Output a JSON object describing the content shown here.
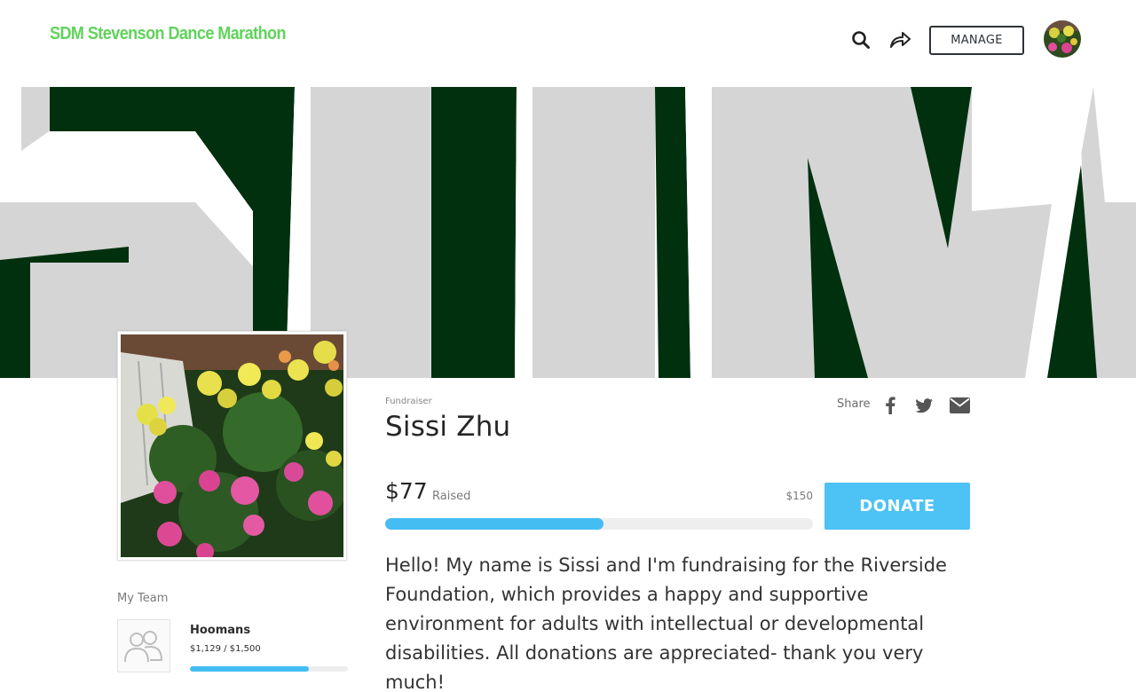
{
  "header": {
    "brand": "SDM Stevenson Dance Marathon",
    "search_icon": "search-icon",
    "share_icon": "share-arrow-icon",
    "manage_label": "MANAGE",
    "avatar_alt": "user avatar"
  },
  "fundraiser": {
    "role": "Fundraiser",
    "name": "Sissi Zhu",
    "raised": "$77",
    "raised_label": "Raised",
    "goal": "$150",
    "progress_fraction": 0.51,
    "donate_label": "DONATE",
    "story": "Hello! My name is Sissi and I'm fundraising for the Riverside Foundation, which provides a happy and supportive environment for adults with intellectual or developmental disabilities. All donations are appreciated- thank you very much!"
  },
  "share": {
    "label": "Share",
    "icons": [
      "facebook-icon",
      "twitter-icon",
      "email-icon"
    ]
  },
  "team": {
    "heading": "My Team",
    "name": "Hoomans",
    "amount": "$1,129 / $1,500",
    "progress_fraction": 0.75
  },
  "colors": {
    "brand_green": "#5fd35a",
    "banner_dark_green": "#01300f",
    "banner_gray": "#d5d5d5",
    "accent_blue": "#4cc2f5",
    "progress_blue": "#44bdf2"
  }
}
